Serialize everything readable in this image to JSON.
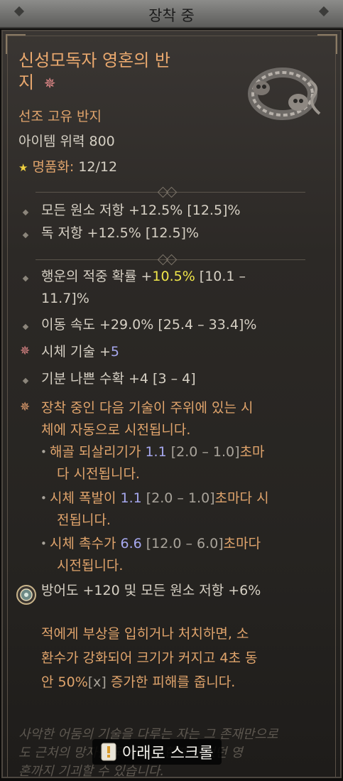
{
  "header": {
    "title": "장착 중"
  },
  "item": {
    "name_line1": "신성모독자 영혼의 반",
    "name_line2": "지",
    "type": "선조 고유 반지",
    "power": "아이템 위력 800",
    "masterwork_label": "명품화:",
    "masterwork_value": "12/12"
  },
  "implicits": [
    {
      "text": "모든 원소 저항 +12.5% [12.5]%"
    },
    {
      "text": "독 저항 +12.5% [12.5]%"
    }
  ],
  "affixes": {
    "luck_line1_prefix": "행운의 적중 확률 +",
    "luck_value": "10.5%",
    "luck_line1_suffix": " [10.1 –",
    "luck_line2": "11.7]%",
    "move_speed": "이동 속도 +29.0% [25.4 – 33.4]%",
    "corpse_prefix": "시체 기술 +",
    "corpse_value": "5",
    "bad_harvest": "기분 나쁜 수확 +4 [3 – 4]"
  },
  "auto_cast": {
    "line1": "장착 중인 다음 기술이 주위에 있는 시",
    "line2": "체에 자동으로 시전됩니다.",
    "skills": [
      {
        "name": "해골 되살리기가 ",
        "value": "1.1",
        "range": " [2.0 – 1.0]",
        "suffix": "초마",
        "line2": "다 시전됩니다."
      },
      {
        "name": "시체 폭발이 ",
        "value": "1.1",
        "range": " [2.0 – 1.0]",
        "suffix": "초마다 시",
        "line2": "전됩니다."
      },
      {
        "name": "시체 촉수가 ",
        "value": "6.6",
        "range": " [12.0 – 6.0]",
        "suffix": "초마다",
        "line2": "시전됩니다."
      }
    ]
  },
  "socket": {
    "text": "방어도 +120 및 모든 원소 저항 +6%"
  },
  "unique_effect": {
    "line1": "적에게 부상을 입히거나 처치하면, 소",
    "line2": "환수가 강화되어 크기가 커지고 4초 동",
    "line3_prefix": "안 50%",
    "line3_x": "[x]",
    "line3_suffix": " 증가한 피해를 줍니다."
  },
  "flavor": {
    "line1": "사악한 어둠의 기술을 다루는 자는 그 존재만으로",
    "line2": "도 근처의 망자를 되살리고 한때 들었던 영",
    "line3": "혼까지 기괴할 수 있습니다."
  },
  "scroll_hint": {
    "label": "아래로 스크롤"
  },
  "colors": {
    "item_name": "#e9a86e",
    "highlight_yellow": "#f0e64a",
    "highlight_blue": "#a6a8ee",
    "text": "#d6d0c4"
  }
}
